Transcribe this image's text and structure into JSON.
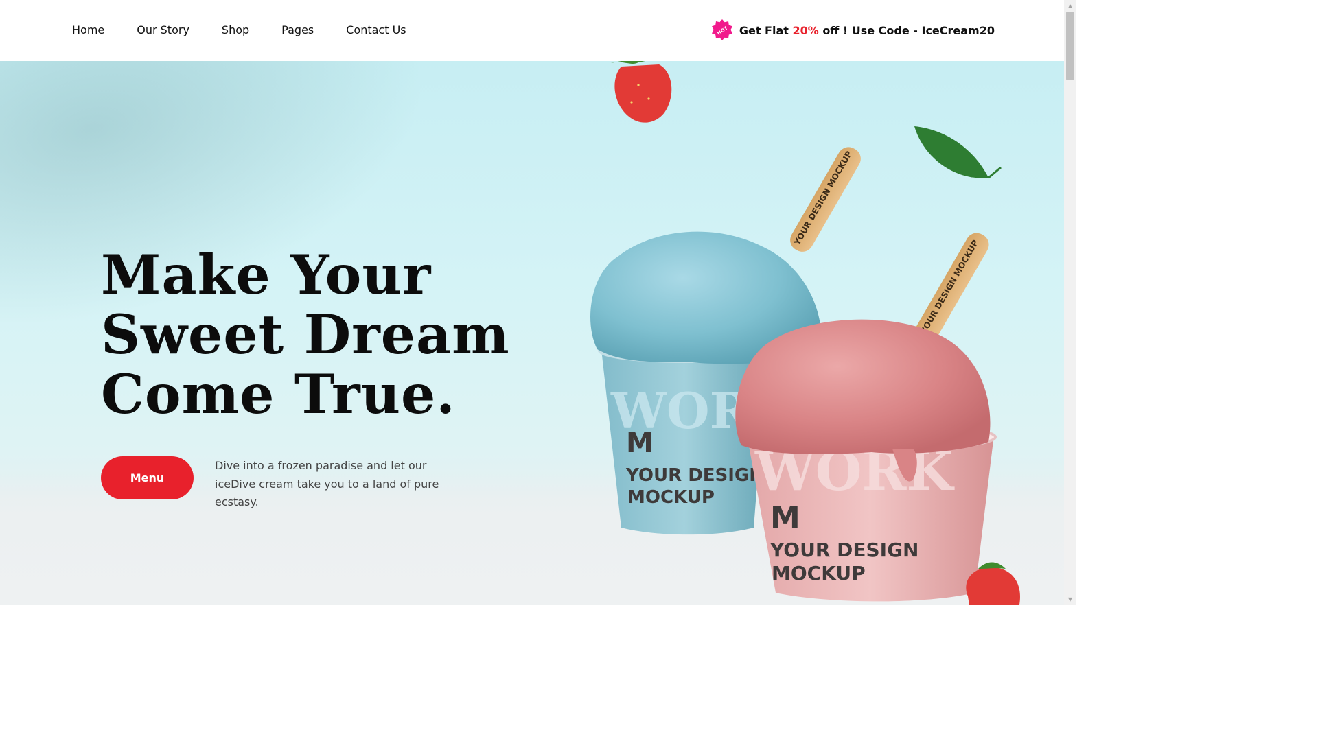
{
  "nav": {
    "items": [
      {
        "label": "Home"
      },
      {
        "label": "Our Story"
      },
      {
        "label": "Shop"
      },
      {
        "label": "Pages"
      },
      {
        "label": "Contact Us"
      }
    ]
  },
  "promo": {
    "badge_text": "HOT",
    "prefix": "Get Flat ",
    "discount": "20%",
    "suffix": " off ! Use Code - IceCream20",
    "accent_color": "#e8212c",
    "badge_color": "#f11a8c"
  },
  "hero": {
    "headline_lines": [
      "Make Your",
      "Sweet Dream",
      "Come True."
    ],
    "cta_label": "Menu",
    "description": "Dive into a frozen paradise and let our iceDive cream take you to a land of pure ecstasy."
  },
  "product_art": {
    "cup_text_line1": "YOUR DESIGN",
    "cup_text_line2": "MOCKUP",
    "stick_text": "YOUR DESIGN MOCKUP",
    "cup_back_pattern": "WORK",
    "blue_color": "#7fc0d0",
    "pink_color": "#e8a3a4"
  },
  "scrollbar": {
    "up_icon": "▲",
    "down_icon": "▼"
  }
}
